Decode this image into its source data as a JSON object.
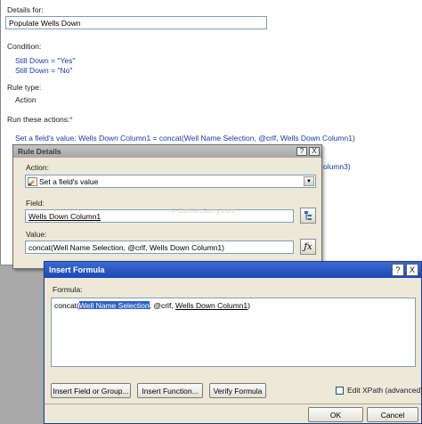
{
  "rule_pane": {
    "details_for_label": "Details for:",
    "details_for_value": "Populate Wells Down",
    "condition_label": "Condition:",
    "conditions": [
      "Still Down = \"Yes\"",
      "Still Down = \"No\""
    ],
    "rule_type_label": "Rule type:",
    "rule_type_value": "Action",
    "run_actions_label": "Run these actions:",
    "run_actions_required": "*",
    "action_line_1": "Set a field's value: Wells Down Column1 = concat(Well Name Selection, @crlf, Wells Down Column1)",
    "action_line_2_fragment": "olumn3)"
  },
  "rule_details": {
    "title": "Rule Details",
    "help_button": "?",
    "close_button": "X",
    "action_label": "Action:",
    "action_value": "Set a field's value",
    "field_label": "Field:",
    "field_value": "Wells Down Column1",
    "value_label": "Value:",
    "value_value": "concat(Well Name Selection, @crlf, Wells Down Column1)"
  },
  "watermark": "© DotNetSurry.com",
  "insert_formula": {
    "title": "Insert Formula",
    "help_button": "?",
    "close_button": "X",
    "formula_label": "Formula:",
    "formula_prefix": "concat(",
    "formula_selected": "Well Name Selection",
    "formula_mid": ", @crlf, ",
    "formula_ref": "Wells Down Column1",
    "formula_suffix": ")",
    "insert_field_button": "Insert Field or Group...",
    "insert_function_button": "Insert Function...",
    "verify_button": "Verify Formula",
    "edit_xpath_label": "Edit XPath (advanced)",
    "edit_xpath_checked": false,
    "ok_button": "OK",
    "cancel_button": "Cancel"
  },
  "colors": {
    "condition_text": "#1a3ca5",
    "title_bar_active": "#1d47b4",
    "selection": "#3163c5"
  }
}
